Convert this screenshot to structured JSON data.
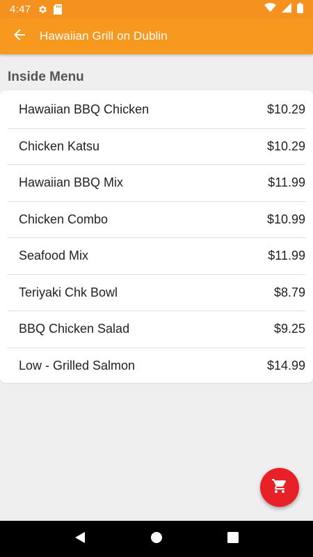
{
  "status_bar": {
    "time": "4:47",
    "icons": [
      "settings-icon",
      "sd-card-icon",
      "wifi-icon",
      "signal-icon",
      "battery-icon"
    ]
  },
  "app_bar": {
    "title": "Hawaiian Grill on Dublin",
    "back_icon": "arrow-back-icon",
    "color": "#f7981f"
  },
  "section": {
    "title": "Inside Menu"
  },
  "menu": {
    "items": [
      {
        "name": "Hawaiian BBQ Chicken",
        "price": "$10.29"
      },
      {
        "name": "Chicken Katsu",
        "price": "$10.29"
      },
      {
        "name": "Hawaiian BBQ Mix",
        "price": "$11.99"
      },
      {
        "name": "Chicken Combo",
        "price": "$10.99"
      },
      {
        "name": "Seafood Mix",
        "price": "$11.99"
      },
      {
        "name": "Teriyaki Chk Bowl",
        "price": "$8.79"
      },
      {
        "name": "BBQ Chicken Salad",
        "price": "$9.25"
      },
      {
        "name": "Low - Grilled Salmon",
        "price": "$14.99"
      }
    ]
  },
  "fab": {
    "icon": "shopping-cart-icon",
    "color": "#e82027"
  },
  "nav_bar": {
    "buttons": [
      "back-triangle-icon",
      "home-circle-icon",
      "recents-square-icon"
    ]
  }
}
